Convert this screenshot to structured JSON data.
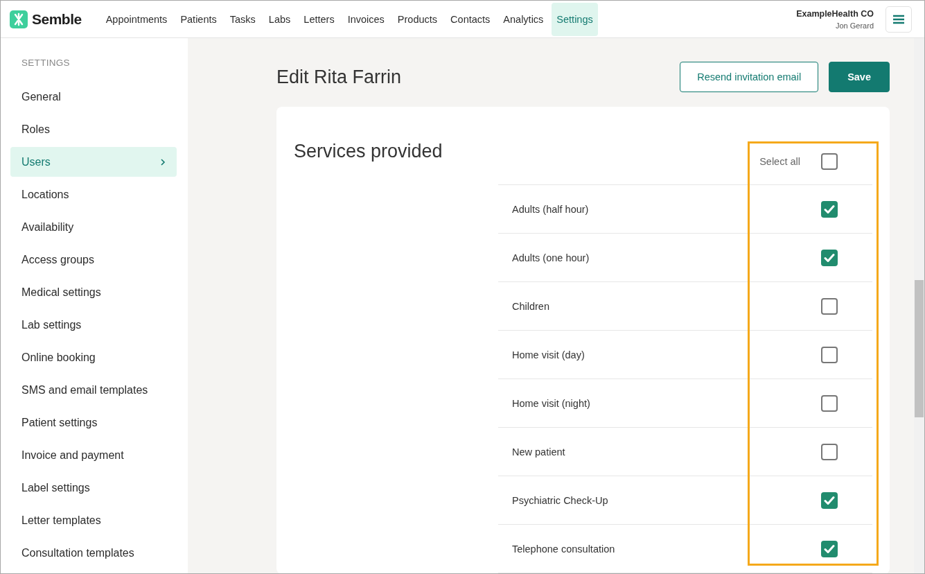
{
  "brand": {
    "name": "Semble"
  },
  "nav": [
    {
      "label": "Appointments",
      "selected": false
    },
    {
      "label": "Patients",
      "selected": false
    },
    {
      "label": "Tasks",
      "selected": false
    },
    {
      "label": "Labs",
      "selected": false
    },
    {
      "label": "Letters",
      "selected": false
    },
    {
      "label": "Invoices",
      "selected": false
    },
    {
      "label": "Products",
      "selected": false
    },
    {
      "label": "Contacts",
      "selected": false
    },
    {
      "label": "Analytics",
      "selected": false
    },
    {
      "label": "Settings",
      "selected": true
    }
  ],
  "account": {
    "organisation": "ExampleHealth CO",
    "user": "Jon Gerard"
  },
  "sidebar": {
    "heading": "SETTINGS",
    "items": [
      {
        "label": "General",
        "selected": false
      },
      {
        "label": "Roles",
        "selected": false
      },
      {
        "label": "Users",
        "selected": true
      },
      {
        "label": "Locations",
        "selected": false
      },
      {
        "label": "Availability",
        "selected": false
      },
      {
        "label": "Access groups",
        "selected": false
      },
      {
        "label": "Medical settings",
        "selected": false
      },
      {
        "label": "Lab settings",
        "selected": false
      },
      {
        "label": "Online booking",
        "selected": false
      },
      {
        "label": "SMS and email templates",
        "selected": false
      },
      {
        "label": "Patient settings",
        "selected": false
      },
      {
        "label": "Invoice and payment",
        "selected": false
      },
      {
        "label": "Label settings",
        "selected": false
      },
      {
        "label": "Letter templates",
        "selected": false
      },
      {
        "label": "Consultation templates",
        "selected": false
      }
    ]
  },
  "page": {
    "title": "Edit Rita Farrin",
    "buttons": [
      {
        "label": "Resend invitation email",
        "kind": "outline"
      },
      {
        "label": "Save",
        "kind": "primary"
      }
    ]
  },
  "services": {
    "title": "Services provided",
    "select_all": {
      "label": "Select all",
      "checked": false
    },
    "items": [
      {
        "label": "Adults (half hour)",
        "checked": true
      },
      {
        "label": "Adults (one hour)",
        "checked": true
      },
      {
        "label": "Children",
        "checked": false
      },
      {
        "label": "Home visit (day)",
        "checked": false
      },
      {
        "label": "Home visit (night)",
        "checked": false
      },
      {
        "label": "New patient",
        "checked": false
      },
      {
        "label": "Psychiatric Check-Up",
        "checked": true
      },
      {
        "label": "Telephone consultation",
        "checked": true
      }
    ]
  }
}
